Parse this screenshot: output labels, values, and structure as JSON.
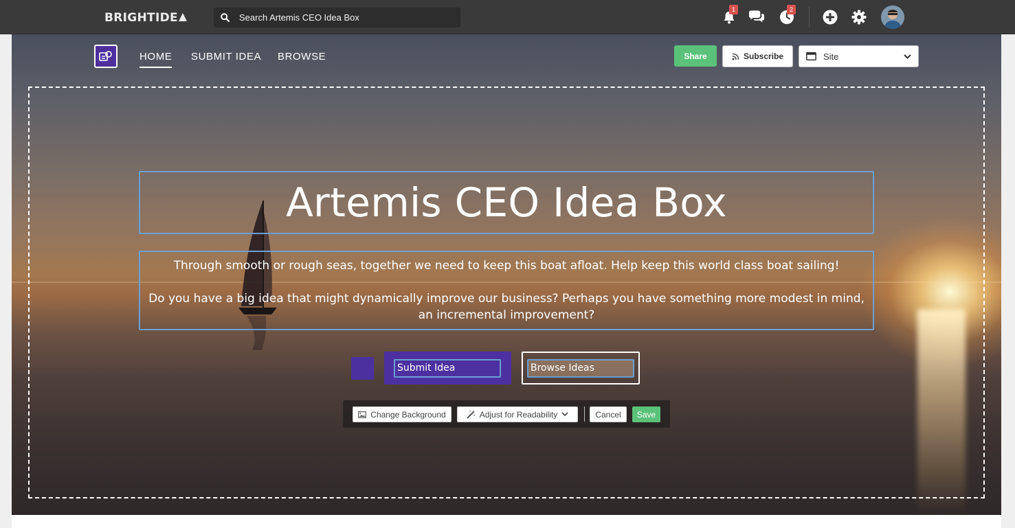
{
  "topbar": {
    "logo_text": "BRIGHTIDE",
    "search_placeholder": "Search Artemis CEO Idea Box",
    "notifications_count": "1",
    "activity_count": "2",
    "icons": [
      "bell-icon",
      "chat-icon",
      "clock-icon",
      "plus-circle-icon",
      "gear-icon",
      "avatar"
    ]
  },
  "site_nav": {
    "items": [
      {
        "label": "HOME",
        "active": true
      },
      {
        "label": "SUBMIT IDEA",
        "active": false
      },
      {
        "label": "BROWSE",
        "active": false
      }
    ],
    "share_label": "Share",
    "subscribe_label": "Subscribe",
    "site_select_value": "Site"
  },
  "hero": {
    "title": "Artemis CEO Idea Box",
    "description_1": "Through smooth or rough seas, together we need to keep this boat afloat. Help keep this world class boat sailing!",
    "description_2": "Do you have a big idea that might dynamically improve our business? Perhaps you have something more modest in mind, an incremental improvement?",
    "submit_button_label": "Submit Idea",
    "browse_button_label": "Browse Ideas",
    "accent_color": "#4d30a0"
  },
  "edit_toolbar": {
    "change_background_label": "Change Background",
    "adjust_readability_label": "Adjust for Readability",
    "cancel_label": "Cancel",
    "save_label": "Save"
  },
  "colors": {
    "topbar_bg": "#3a3a3a",
    "share_green": "#5bc27a",
    "edit_outline_blue": "#6a9fd4",
    "badge_red": "#d9534f"
  }
}
